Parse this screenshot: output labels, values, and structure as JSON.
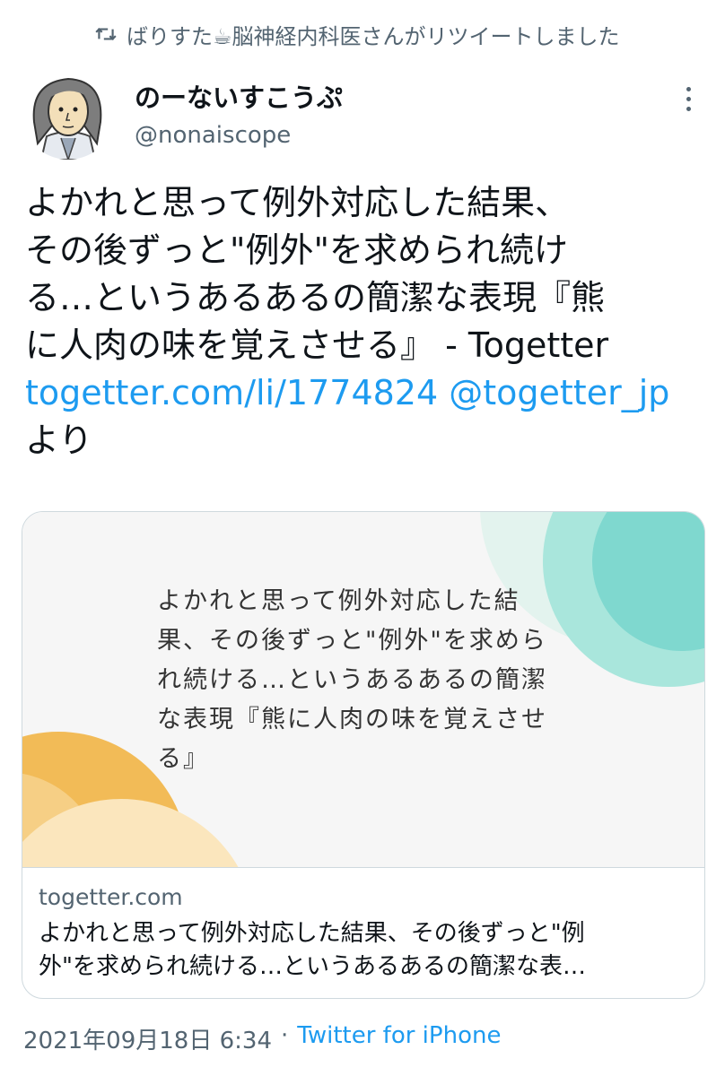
{
  "retweet": {
    "text": "ばりすた☕脳神経内科医さんがリツイートしました"
  },
  "author": {
    "name": "のーないすこうぷ",
    "handle": "@nonaiscope"
  },
  "tweet": {
    "text": "よかれと思って例外対応した結果、\nその後ずっと\"例外\"を求められ続け\nる…というあるあるの簡潔な表現『熊\nに人肉の味を覚えさせる』 - Togetter\n",
    "link_url": "togetter.com/li/1774824",
    "mention": "@togetter_jp",
    "suffix": "より"
  },
  "card": {
    "image_text": "よかれと思って例外対応した結\n果、その後ずっと\"例外\"を求めら\nれ続ける…というあるあるの簡潔\nな表現『熊に人肉の味を覚えさせ\nる』",
    "domain": "togetter.com",
    "title": "よかれと思って例外対応した結果、その後ずっと\"例\n外\"を求められ続ける…というあるあるの簡潔な表…"
  },
  "meta": {
    "datetime": "2021年09月18日 6:34",
    "separator": "·",
    "source": "Twitter for iPhone"
  },
  "colors": {
    "link": "#1d9bf0",
    "secondary_text": "#536471",
    "card_accent_teal": "#7fd8cf",
    "card_accent_orange": "#f2bb57"
  }
}
